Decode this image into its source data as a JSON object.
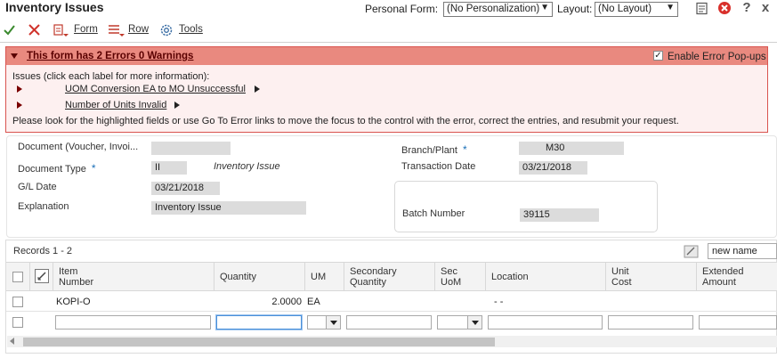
{
  "app": {
    "title": "Inventory Issues",
    "personal_form_label": "Personal Form:",
    "personal_form_value": "(No Personalization)",
    "layout_label": "Layout:",
    "layout_value": "(No Layout)",
    "close_glyph": "x",
    "help_glyph": "?"
  },
  "toolbar": {
    "form_label": "Form",
    "row_label": "Row",
    "tools_label": "Tools"
  },
  "errors": {
    "title": "This form has 2 Errors 0 Warnings",
    "popup_label": "Enable Error Pop-ups",
    "popup_checked": true,
    "issues_intro": "Issues (click each label for more information):",
    "items": [
      {
        "label": "UOM Conversion EA to MO Unsuccessful"
      },
      {
        "label": "Number of Units Invalid"
      }
    ],
    "instructions": "Please look for the highlighted fields or use Go To Error links to move the focus to the control with the error, correct the entries, and resubmit your request."
  },
  "header": {
    "document_label": "Document (Voucher, Invoi...",
    "document_value": "",
    "document_type_label": "Document Type",
    "document_type_value": "II",
    "document_type_desc": "Inventory Issue",
    "gl_date_label": "G/L Date",
    "gl_date_value": "03/21/2018",
    "explanation_label": "Explanation",
    "explanation_value": "Inventory Issue",
    "branch_plant_label": "Branch/Plant",
    "branch_plant_value": "M30",
    "transaction_date_label": "Transaction Date",
    "transaction_date_value": "03/21/2018",
    "batch_number_label": "Batch Number",
    "batch_number_value": "39115",
    "required_marker": "*"
  },
  "grid": {
    "records_label": "Records 1 - 2",
    "query_name": "new name",
    "columns": [
      {
        "line1": "Item",
        "line2": "Number"
      },
      {
        "line1": "Quantity",
        "line2": ""
      },
      {
        "line1": "UM",
        "line2": ""
      },
      {
        "line1": "Secondary",
        "line2": "Quantity"
      },
      {
        "line1": "Sec",
        "line2": "UoM"
      },
      {
        "line1": "Location",
        "line2": ""
      },
      {
        "line1": "Unit",
        "line2": "Cost"
      },
      {
        "line1": "Extended",
        "line2": "Amount"
      }
    ],
    "rows": [
      {
        "item_number": "KOPI-O",
        "quantity": "2.0000",
        "um": "EA",
        "secondary_quantity": "",
        "sec_uom": "",
        "location": "-   -",
        "unit_cost": "",
        "extended_amount": ""
      }
    ]
  },
  "colors": {
    "error_header": "#e9897f",
    "error_border": "#d9534f",
    "required_star": "#1a6fb7",
    "field_bg": "#dcdcdc"
  },
  "icons": [
    "checkmark-icon",
    "cancel-x-icon",
    "form-menu-icon",
    "row-menu-icon",
    "tools-gear-icon",
    "notes-icon",
    "error-stop-icon",
    "help-icon",
    "close-icon"
  ]
}
